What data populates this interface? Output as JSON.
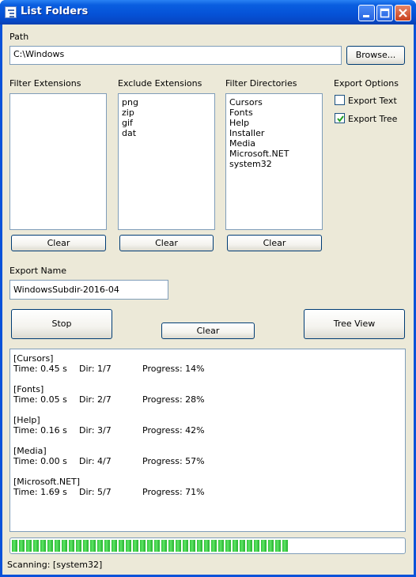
{
  "window": {
    "title": "List Folders"
  },
  "path": {
    "label": "Path",
    "value": "C:\\Windows",
    "browse_label": "Browse..."
  },
  "filter_extensions": {
    "label": "Filter Extensions",
    "items": [],
    "clear_label": "Clear"
  },
  "exclude_extensions": {
    "label": "Exclude Extensions",
    "items": [
      "png",
      "zip",
      "gif",
      "dat"
    ],
    "clear_label": "Clear"
  },
  "filter_directories": {
    "label": "Filter Directories",
    "items": [
      "Cursors",
      "Fonts",
      "Help",
      "Installer",
      "Media",
      "Microsoft.NET",
      "system32"
    ],
    "clear_label": "Clear"
  },
  "export_options": {
    "label": "Export Options",
    "export_text": {
      "label": "Export Text",
      "checked": false
    },
    "export_tree": {
      "label": "Export Tree",
      "checked": true
    }
  },
  "export_name": {
    "label": "Export Name",
    "value": "WindowsSubdir-2016-04"
  },
  "actions": {
    "stop_label": "Stop",
    "clear_label": "Clear",
    "tree_view_label": "Tree View"
  },
  "log": {
    "entries": [
      {
        "name": "[Cursors]",
        "time": "Time: 0.45 s",
        "dir": "Dir: 1/7",
        "progress": "Progress: 14%"
      },
      {
        "name": "[Fonts]",
        "time": "Time: 0.05 s",
        "dir": "Dir: 2/7",
        "progress": "Progress: 28%"
      },
      {
        "name": "[Help]",
        "time": "Time: 0.16 s",
        "dir": "Dir: 3/7",
        "progress": "Progress: 42%"
      },
      {
        "name": "[Media]",
        "time": "Time: 0.00 s",
        "dir": "Dir: 4/7",
        "progress": "Progress: 57%"
      },
      {
        "name": "[Microsoft.NET]",
        "time": "Time: 1.69 s",
        "dir": "Dir: 5/7",
        "progress": "Progress: 71%"
      }
    ]
  },
  "progress": {
    "fraction": 0.71,
    "color": "#31c23a"
  },
  "status": {
    "text": "Scanning: [system32]"
  }
}
